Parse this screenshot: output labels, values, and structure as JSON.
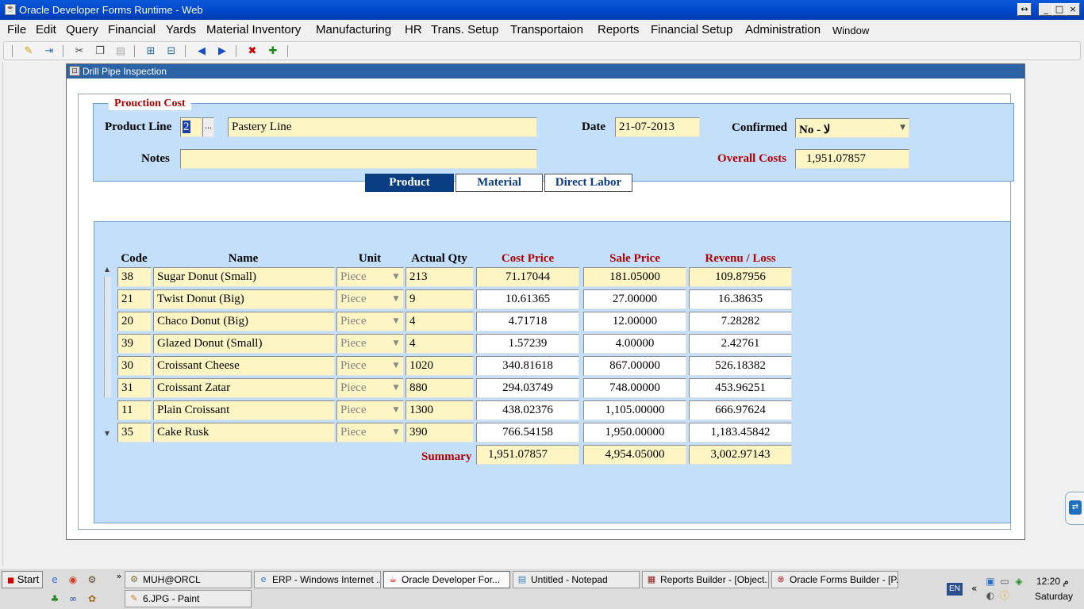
{
  "window": {
    "title": "Oracle Developer Forms Runtime - Web"
  },
  "menu": [
    "File",
    "Edit",
    "Query",
    "Financial",
    "Yards",
    "Material Inventory",
    "Manufacturing",
    "HR",
    "Trans. Setup",
    "Transportaion",
    "Reports",
    "Financial Setup",
    "Administration",
    "Window"
  ],
  "form": {
    "title": "Drill Pipe Inspection",
    "frame_title": "Prouction Cost",
    "product_line_label": "Product Line",
    "product_line_code": "2",
    "product_line_name": "Pastery Line",
    "lov_button": "...",
    "date_label": "Date",
    "date_value": "21-07-2013",
    "confirmed_label": "Confirmed",
    "confirmed_value": "No - لا",
    "notes_label": "Notes",
    "notes_value": "",
    "overall_costs_label": "Overall Costs",
    "overall_costs_value": "1,951.07857"
  },
  "tabs": [
    {
      "label": "Product",
      "active": true
    },
    {
      "label": "Material",
      "active": false
    },
    {
      "label": "Direct Labor",
      "active": false
    }
  ],
  "table": {
    "headers": [
      "Code",
      "Name",
      "Unit",
      "Actual Qty",
      "Cost Price",
      "Sale Price",
      "Revenu / Loss"
    ],
    "rows": [
      {
        "code": "38",
        "name": "Sugar Donut (Small)",
        "unit": "Piece",
        "qty": "213",
        "cost": "71.17044",
        "sale": "181.05000",
        "rev": "109.87956"
      },
      {
        "code": "21",
        "name": "Twist Donut (Big)",
        "unit": "Piece",
        "qty": "9",
        "cost": "10.61365",
        "sale": "27.00000",
        "rev": "16.38635"
      },
      {
        "code": "20",
        "name": "Chaco Donut (Big)",
        "unit": "Piece",
        "qty": "4",
        "cost": "4.71718",
        "sale": "12.00000",
        "rev": "7.28282"
      },
      {
        "code": "39",
        "name": "Glazed Donut (Small)",
        "unit": "Piece",
        "qty": "4",
        "cost": "1.57239",
        "sale": "4.00000",
        "rev": "2.42761"
      },
      {
        "code": "30",
        "name": "Croissant Cheese",
        "unit": "Piece",
        "qty": "1020",
        "cost": "340.81618",
        "sale": "867.00000",
        "rev": "526.18382"
      },
      {
        "code": "31",
        "name": "Croissant Zatar",
        "unit": "Piece",
        "qty": "880",
        "cost": "294.03749",
        "sale": "748.00000",
        "rev": "453.96251"
      },
      {
        "code": "11",
        "name": "Plain Croissant",
        "unit": "Piece",
        "qty": "1300",
        "cost": "438.02376",
        "sale": "1,105.00000",
        "rev": "666.97624"
      },
      {
        "code": "35",
        "name": "Cake Rusk",
        "unit": "Piece",
        "qty": "390",
        "cost": "766.54158",
        "sale": "1,950.00000",
        "rev": "1,183.45842"
      }
    ],
    "summary_label": "Summary",
    "summary": {
      "cost": "1,951.07857",
      "sale": "4,954.05000",
      "rev": "3,002.97143"
    }
  },
  "taskbar": {
    "start": "Start",
    "tasks": [
      "MUH@ORCL",
      "ERP - Windows Internet ...",
      "Oracle Developer For...",
      "Untitled - Notepad",
      "Reports Builder - [Object...",
      "Oracle Forms Builder - [P...",
      "6.JPG - Paint"
    ],
    "lang": "EN",
    "time": "12:20 م",
    "day": "Saturday"
  }
}
